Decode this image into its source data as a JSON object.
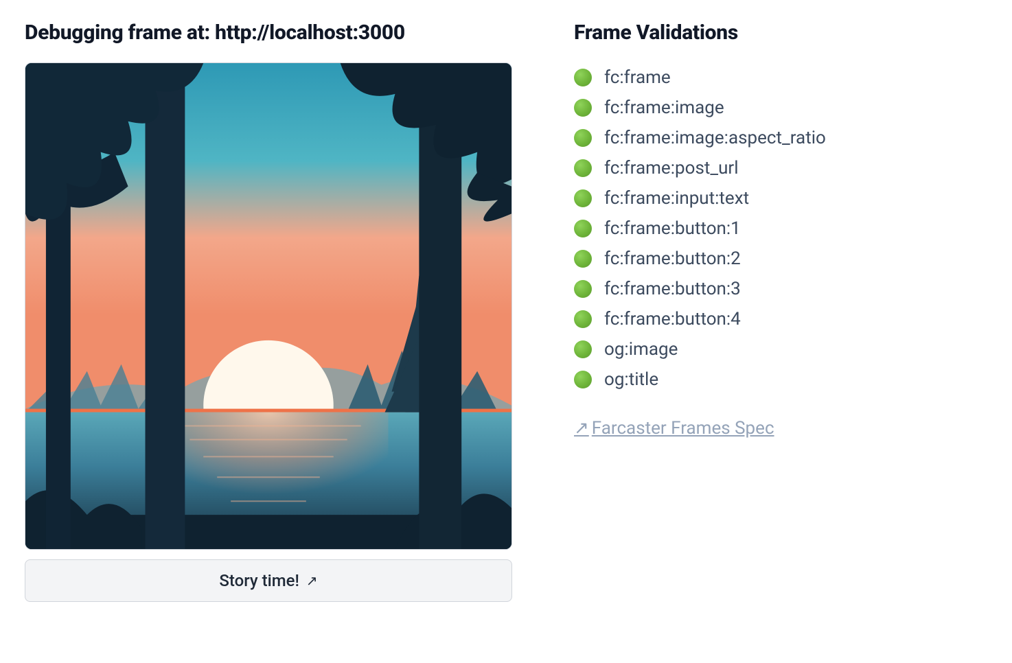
{
  "header": {
    "title": "Debugging frame at: http://localhost:3000"
  },
  "frame": {
    "button_label": "Story time!",
    "button_arrow": "↗"
  },
  "validations": {
    "title": "Frame Validations",
    "items": [
      {
        "status": "pass",
        "label": "fc:frame"
      },
      {
        "status": "pass",
        "label": "fc:frame:image"
      },
      {
        "status": "pass",
        "label": "fc:frame:image:aspect_ratio"
      },
      {
        "status": "pass",
        "label": "fc:frame:post_url"
      },
      {
        "status": "pass",
        "label": "fc:frame:input:text"
      },
      {
        "status": "pass",
        "label": "fc:frame:button:1"
      },
      {
        "status": "pass",
        "label": "fc:frame:button:2"
      },
      {
        "status": "pass",
        "label": "fc:frame:button:3"
      },
      {
        "status": "pass",
        "label": "fc:frame:button:4"
      },
      {
        "status": "pass",
        "label": "og:image"
      },
      {
        "status": "pass",
        "label": "og:title"
      }
    ],
    "spec_link_arrow": "↗",
    "spec_link_label": "Farcaster Frames Spec"
  }
}
